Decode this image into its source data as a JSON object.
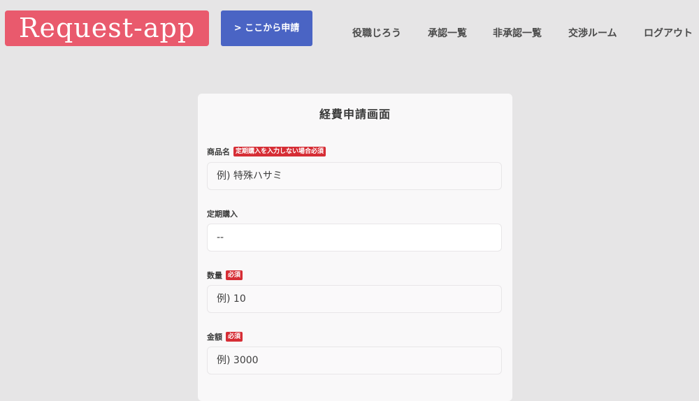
{
  "header": {
    "logo": "Request-app",
    "apply_button": "> ここから申請",
    "nav": [
      {
        "label": "役職じろう"
      },
      {
        "label": "承認一覧"
      },
      {
        "label": "非承認一覧"
      },
      {
        "label": "交渉ルーム"
      },
      {
        "label": "ログアウト"
      }
    ]
  },
  "form": {
    "title": "経費申請画面",
    "fields": {
      "product_name": {
        "label": "商品名",
        "badge": "定期購入を入力しない場合必須",
        "placeholder": "例) 特殊ハサミ"
      },
      "subscription": {
        "label": "定期購入",
        "value": "--"
      },
      "quantity": {
        "label": "数量",
        "badge": "必須",
        "placeholder": "例) 10"
      },
      "amount": {
        "label": "金額",
        "badge": "必須",
        "placeholder": "例) 3000"
      }
    }
  },
  "colors": {
    "logo_bg": "#e95a6d",
    "button_bg": "#4a64c4",
    "badge_bg": "#d62d35",
    "page_bg": "#e6e5e6"
  }
}
